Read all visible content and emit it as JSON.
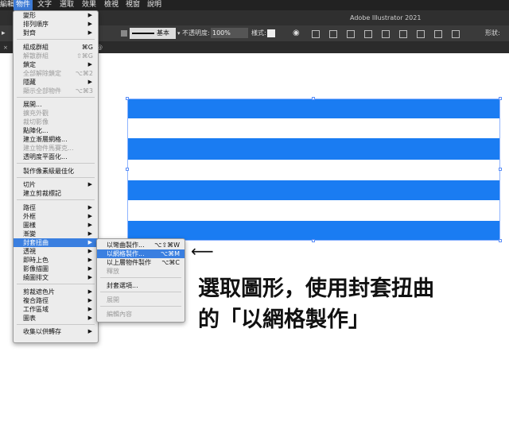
{
  "menubar": {
    "items": [
      "編輯",
      "物件",
      "文字",
      "選取",
      "效果",
      "檢視",
      "視窗",
      "說明"
    ]
  },
  "app_title": "Adobe Illustrator 2021",
  "control": {
    "stroke_label": "基本",
    "opacity_label": "不透明度:",
    "opacity_value": "100%",
    "style_label": "樣式:",
    "shape_label": "形狀:"
  },
  "doc_tab": "@",
  "object_menu": {
    "groups": [
      [
        {
          "label": "變形",
          "arrow": true
        },
        {
          "label": "排列順序",
          "arrow": true
        },
        {
          "label": "對齊",
          "arrow": true
        }
      ],
      [
        {
          "label": "組成群組",
          "shortcut": "⌘G"
        },
        {
          "label": "解散群組",
          "shortcut": "⇧⌘G",
          "disabled": true
        },
        {
          "label": "鎖定",
          "arrow": true
        },
        {
          "label": "全部解除鎖定",
          "shortcut": "⌥⌘2",
          "disabled": true
        },
        {
          "label": "隱藏",
          "arrow": true
        },
        {
          "label": "顯示全部物件",
          "shortcut": "⌥⌘3",
          "disabled": true
        }
      ],
      [
        {
          "label": "展開..."
        },
        {
          "label": "擴充外觀",
          "disabled": true
        },
        {
          "label": "裁切影像",
          "disabled": true
        },
        {
          "label": "點陣化..."
        },
        {
          "label": "建立漸層網格..."
        },
        {
          "label": "建立物件馬賽克...",
          "disabled": true
        },
        {
          "label": "透明度平面化..."
        }
      ],
      [
        {
          "label": "製作像素級最佳化"
        }
      ],
      [
        {
          "label": "切片",
          "arrow": true
        },
        {
          "label": "建立剪裁標記"
        }
      ],
      [
        {
          "label": "路徑",
          "arrow": true
        },
        {
          "label": "外框",
          "arrow": true
        },
        {
          "label": "圖樣",
          "arrow": true
        },
        {
          "label": "漸變",
          "arrow": true
        },
        {
          "label": "封套扭曲",
          "arrow": true,
          "highlighted": true
        },
        {
          "label": "透視",
          "arrow": true
        },
        {
          "label": "即時上色",
          "arrow": true
        },
        {
          "label": "影像描圖",
          "arrow": true
        },
        {
          "label": "繞圖排文",
          "arrow": true
        }
      ],
      [
        {
          "label": "剪裁遮色片",
          "arrow": true
        },
        {
          "label": "複合路徑",
          "arrow": true
        },
        {
          "label": "工作區域",
          "arrow": true
        },
        {
          "label": "圖表",
          "arrow": true
        }
      ],
      [
        {
          "label": "收集以供轉存",
          "arrow": true
        }
      ]
    ]
  },
  "envelope_submenu": {
    "groups": [
      [
        {
          "label": "以彎曲製作...",
          "shortcut": "⌥⇧⌘W"
        },
        {
          "label": "以網格製作...",
          "shortcut": "⌥⌘M",
          "highlighted": true
        },
        {
          "label": "以上層物件製作",
          "shortcut": "⌥⌘C"
        },
        {
          "label": "釋放",
          "disabled": true
        }
      ],
      [
        {
          "label": "封套選項..."
        }
      ],
      [
        {
          "label": "展開",
          "disabled": true
        }
      ],
      [
        {
          "label": "編輯內容",
          "disabled": true
        }
      ]
    ]
  },
  "annotation": {
    "arrow": "⟵",
    "line1": "選取圖形，使用封套扭曲",
    "line2": "的「以網格製作」"
  },
  "colors": {
    "stripe_blue": "#1a7cf2",
    "menu_highlight": "#3a7fe0",
    "menubar_bg": "#222222"
  }
}
